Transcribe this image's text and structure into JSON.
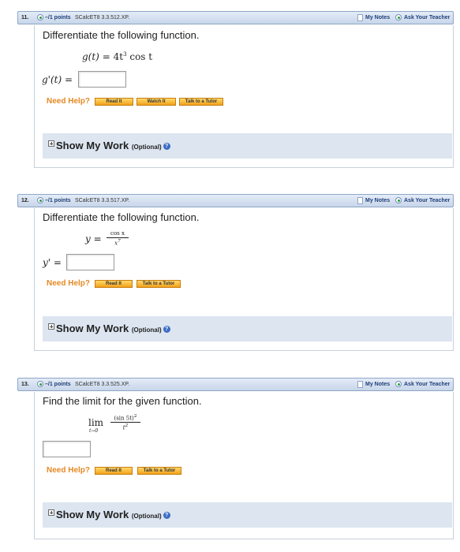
{
  "header": {
    "my_notes": "My Notes",
    "ask_teacher": "Ask Your Teacher"
  },
  "questions": [
    {
      "number": "11.",
      "points": "–/1 points",
      "code": "SCalcET8 3.3.512.XP.",
      "prompt": "Differentiate the following function.",
      "function_lhs": "g(t)",
      "function_eq": "=",
      "function_rhs_coef": "4t",
      "function_rhs_exp": "3",
      "function_rhs_tail": "cos t",
      "answer_label": "g'(t) =",
      "answer_value": "",
      "help_label": "Need Help?",
      "buttons": [
        "Read It",
        "Watch It",
        "Talk to a Tutor"
      ],
      "show_work": "Show My Work",
      "optional": "(Optional)"
    },
    {
      "number": "12.",
      "points": "–/1 points",
      "code": "SCalcET8 3.3.517.XP.",
      "prompt": "Differentiate the following function.",
      "function_lhs": "y =",
      "frac_num": "cos x",
      "frac_den": "x",
      "frac_den_exp": "7",
      "answer_label": "y' =",
      "answer_value": "",
      "help_label": "Need Help?",
      "buttons": [
        "Read It",
        "Talk to a Tutor"
      ],
      "show_work": "Show My Work",
      "optional": "(Optional)"
    },
    {
      "number": "13.",
      "points": "–/1 points",
      "code": "SCalcET8 3.3.525.XP.",
      "prompt": "Find the limit for the given function.",
      "limit_word": "lim",
      "limit_sub": "t→0",
      "frac_num": "(sin 5t)",
      "frac_num_exp": "2",
      "frac_den": "t",
      "frac_den_exp": "2",
      "answer_value": "",
      "help_label": "Need Help?",
      "buttons": [
        "Read It",
        "Talk to a Tutor"
      ],
      "show_work": "Show My Work",
      "optional": "(Optional)"
    }
  ],
  "help_icon": "question-mark-icon"
}
